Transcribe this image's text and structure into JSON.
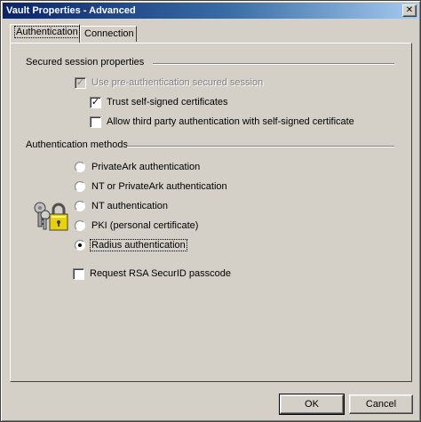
{
  "window": {
    "title": "Vault Properties - Advanced",
    "close_glyph": "✕"
  },
  "tabs": [
    {
      "label": "Authentication",
      "active": true
    },
    {
      "label": "Connection",
      "active": false
    }
  ],
  "secured_session": {
    "heading": "Secured session properties",
    "use_pre_auth": {
      "label": "Use pre-authentication secured session",
      "checked": true,
      "enabled": false
    },
    "trust_self_signed": {
      "label": "Trust self-signed certificates",
      "checked": true
    },
    "allow_third_party": {
      "label": "Allow third party authentication with self-signed certificate",
      "checked": false
    }
  },
  "auth_methods": {
    "heading": "Authentication methods",
    "icon": "keys-padlock-icon",
    "options": [
      {
        "label": "PrivateArk authentication",
        "selected": false
      },
      {
        "label": "NT or PrivateArk authentication",
        "selected": false
      },
      {
        "label": "NT authentication",
        "selected": false
      },
      {
        "label": "PKI (personal certificate)",
        "selected": false
      },
      {
        "label": "Radius authentication",
        "selected": true
      }
    ],
    "rsa_passcode": {
      "label": "Request RSA SecurID passcode",
      "checked": false
    }
  },
  "buttons": {
    "ok": "OK",
    "cancel": "Cancel"
  },
  "check_glyph": "✓",
  "colors": {
    "titlebar_start": "#0a246a",
    "titlebar_end": "#a6caf0",
    "face": "#d4d0c8",
    "padlock": "#e8d200"
  }
}
